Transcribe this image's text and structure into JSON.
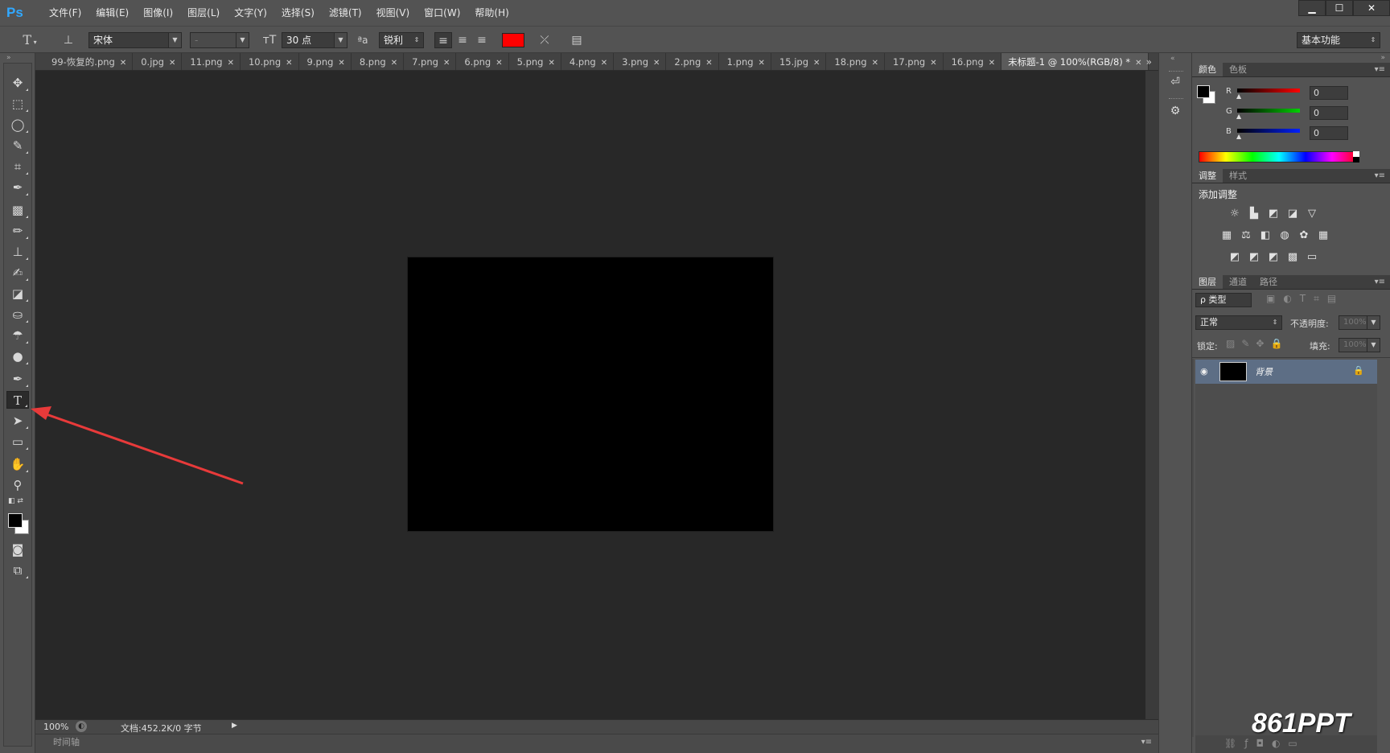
{
  "app": {
    "logo": "Ps",
    "menus": [
      "文件(F)",
      "编辑(E)",
      "图像(I)",
      "图层(L)",
      "文字(Y)",
      "选择(S)",
      "滤镜(T)",
      "视图(V)",
      "窗口(W)",
      "帮助(H)"
    ],
    "window_controls": [
      "▁",
      "☐",
      "✕"
    ]
  },
  "options": {
    "tool_glyph": "T",
    "font_family": "宋体",
    "font_style": "-",
    "font_size": "30 点",
    "size_icon": "ᴛT",
    "aa_icon": "ªa",
    "antialias": "锐利",
    "workspace": "基本功能",
    "text_color": "#ff0000"
  },
  "tabs": [
    {
      "label": "99-恢复的.png",
      "active": false
    },
    {
      "label": "0.jpg",
      "active": false
    },
    {
      "label": "11.png",
      "active": false
    },
    {
      "label": "10.png",
      "active": false
    },
    {
      "label": "9.png",
      "active": false
    },
    {
      "label": "8.png",
      "active": false
    },
    {
      "label": "7.png",
      "active": false
    },
    {
      "label": "6.png",
      "active": false
    },
    {
      "label": "5.png",
      "active": false
    },
    {
      "label": "4.png",
      "active": false
    },
    {
      "label": "3.png",
      "active": false
    },
    {
      "label": "2.png",
      "active": false
    },
    {
      "label": "1.png",
      "active": false
    },
    {
      "label": "15.jpg",
      "active": false
    },
    {
      "label": "18.png",
      "active": false
    },
    {
      "label": "17.png",
      "active": false
    },
    {
      "label": "16.png",
      "active": false
    },
    {
      "label": "未标题-1 @ 100%(RGB/8) *",
      "active": true
    }
  ],
  "tab_overflow": "»",
  "status": {
    "zoom": "100%",
    "doc_info": "文档:452.2K/0 字节",
    "timeline": "时间轴"
  },
  "panels": {
    "color_tabs": [
      "颜色",
      "色板"
    ],
    "rgb": [
      {
        "label": "R",
        "value": "0"
      },
      {
        "label": "G",
        "value": "0"
      },
      {
        "label": "B",
        "value": "0"
      }
    ],
    "adjust_tabs": [
      "调整",
      "样式"
    ],
    "add_adjustment": "添加调整",
    "layer_tabs": [
      "图层",
      "通道",
      "路径"
    ],
    "layer_filter": "ρ 类型",
    "blend_mode": "正常",
    "opacity_label": "不透明度:",
    "opacity_value": "100%",
    "lock_label": "锁定:",
    "fill_label": "填充:",
    "fill_value": "100%",
    "layer_name": "背景"
  },
  "watermark": "861PPT"
}
